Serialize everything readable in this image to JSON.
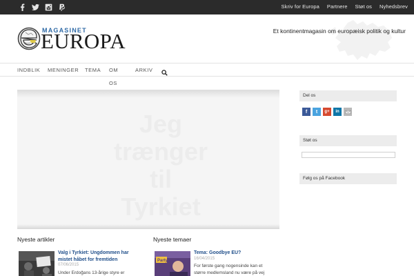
{
  "topbar": {
    "social_icons": [
      "facebook-icon",
      "twitter-icon",
      "instagram-icon",
      "paypal-icon"
    ],
    "links": [
      "Skriv for Europa",
      "Partnere",
      "Støt os",
      "Nyhedsbrev"
    ]
  },
  "header": {
    "logo_small": "MAGASINET",
    "logo_big": "EUROPA",
    "tagline": "Et kontinentmagasin om europæisk politik og kultur"
  },
  "nav": {
    "items": [
      "INDBLIK",
      "MENINGER",
      "TEMA",
      "OM",
      "OS",
      "ARKIV"
    ]
  },
  "slider": {
    "caption_lines": [
      "Jeg",
      "trænger",
      "til",
      "Tyrkiet"
    ]
  },
  "sidebar": {
    "share_title": "Del os",
    "share_icons": [
      "facebook-share-icon",
      "twitter-share-icon",
      "googleplus-share-icon",
      "linkedin-share-icon",
      "email-share-icon"
    ],
    "support_title": "Støt os",
    "facebook_title": "Følg os på Facebook"
  },
  "latest_articles": {
    "title": "Nyeste artikler",
    "card": {
      "title_line1": "Valg i Tyrkiet: Ungdommen har",
      "title_line2": "mistet håbet for fremtiden",
      "date": "07/06/2015",
      "excerpt": "Under Erdoğans 13-årige styre er"
    }
  },
  "latest_themes": {
    "title": "Nyeste temaer",
    "card": {
      "title": "Tema: Goodbye EU?",
      "date": "16/04/2015",
      "excerpt_line1": "For første gang nogensinde kan et",
      "excerpt_line2": "større medlemsland nu være på vej"
    }
  },
  "colors": {
    "topbar": "#2b2b2b",
    "link_blue": "#1f4e8a",
    "logo_blue": "#2f6aa6"
  }
}
